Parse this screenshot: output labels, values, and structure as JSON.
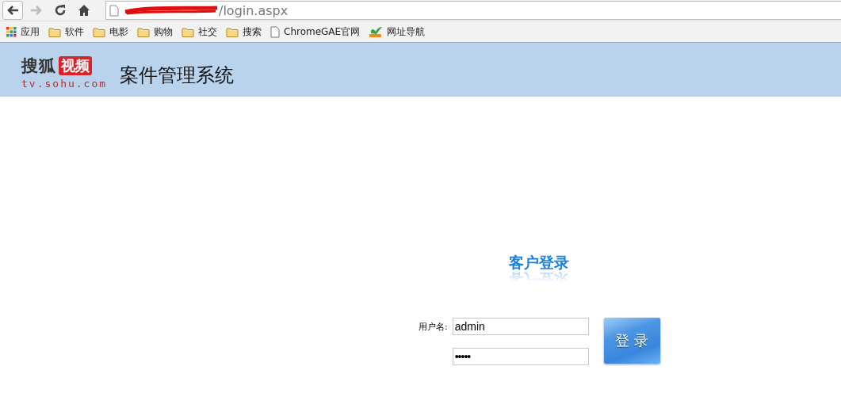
{
  "browser": {
    "url": "/login.aspx",
    "back_enabled": true,
    "forward_enabled": false,
    "bookmarks": [
      {
        "kind": "apps",
        "label": "应用"
      },
      {
        "kind": "folder",
        "label": "软件"
      },
      {
        "kind": "folder",
        "label": "电影"
      },
      {
        "kind": "folder",
        "label": "购物"
      },
      {
        "kind": "folder",
        "label": "社交"
      },
      {
        "kind": "folder",
        "label": "搜索"
      },
      {
        "kind": "page",
        "label": "ChromeGAE官网"
      },
      {
        "kind": "hao",
        "label": "网址导航"
      }
    ]
  },
  "header": {
    "logo_text": "搜狐",
    "logo_badge": "视频",
    "logo_domain": "tv.sohu.com",
    "title": "案件管理系统"
  },
  "login": {
    "heading": "客户登录",
    "username_label": "用户名:",
    "username_value": "admin",
    "password_value": "•••••",
    "button": "登 录"
  }
}
